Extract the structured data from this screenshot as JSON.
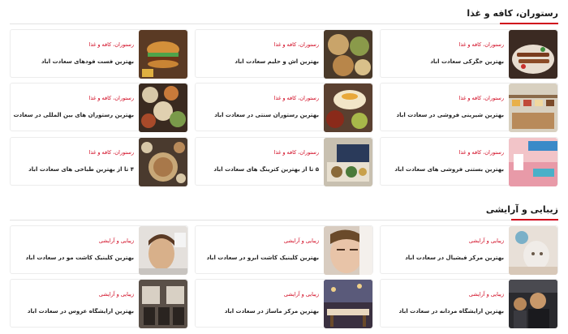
{
  "sections": [
    {
      "title": "رستوران، کافه و غذا",
      "cards": [
        {
          "category": "رستوران، کافه و غذا",
          "title": "بهترین جگرکی سعادت آباد",
          "icon": "kebab-plate-photo"
        },
        {
          "category": "رستوران، کافه و غذا",
          "title": "بهترین آش و حلیم سعادت آباد",
          "icon": "soup-bowls-photo"
        },
        {
          "category": "رستوران، کافه و غذا",
          "title": "بهترین فست فودهای سعادت آباد",
          "icon": "burger-photo"
        },
        {
          "category": "رستوران، کافه و غذا",
          "title": "بهترین شیرینی فروشی در سعادت آباد",
          "icon": "pastry-display-photo"
        },
        {
          "category": "رستوران، کافه و غذا",
          "title": "بهترین رستوران سنتی در سعادت آباد",
          "icon": "persian-dishes-photo"
        },
        {
          "category": "رستوران، کافه و غذا",
          "title": "بهترین رستوران های بین المللی در سعادت آباد",
          "icon": "international-food-photo"
        },
        {
          "category": "رستوران، کافه و غذا",
          "title": "بهترین بستنی فروشی های سعادت آباد",
          "icon": "ice-cream-shop-photo"
        },
        {
          "category": "رستوران، کافه و غذا",
          "title": "۵ تا از بهترین کترینگ های سعادت آباد",
          "icon": "catering-box-photo"
        },
        {
          "category": "رستوران، کافه و غذا",
          "title": "۴ تا از بهترین طباخی های سعادت آباد",
          "icon": "tabakhi-bowls-photo"
        }
      ]
    },
    {
      "title": "زیبایی و آرایشی",
      "cards": [
        {
          "category": "زیبایی و آرایشی",
          "title": "بهترین مرکز فیشیال در سعادت آباد",
          "icon": "facial-mask-photo"
        },
        {
          "category": "زیبایی و آرایشی",
          "title": "بهترین کلینیک کاشت ابرو در سعادت آباد",
          "icon": "eyebrow-treatment-photo"
        },
        {
          "category": "زیبایی و آرایشی",
          "title": "بهترین کلینیک کاشت مو در سعادت آباد",
          "icon": "hair-transplant-photo"
        },
        {
          "category": "زیبایی و آرایشی",
          "title": "بهترین آرایشگاه مردانه در سعادت آباد",
          "icon": "barbershop-photo"
        },
        {
          "category": "زیبایی و آرایشی",
          "title": "بهترین مرکز ماساژ در سعادت آباد",
          "icon": "massage-room-photo"
        },
        {
          "category": "زیبایی و آرایشی",
          "title": "بهترین آرایشگاه عروس در سعادت آباد",
          "icon": "bridal-salon-photo"
        }
      ]
    }
  ]
}
